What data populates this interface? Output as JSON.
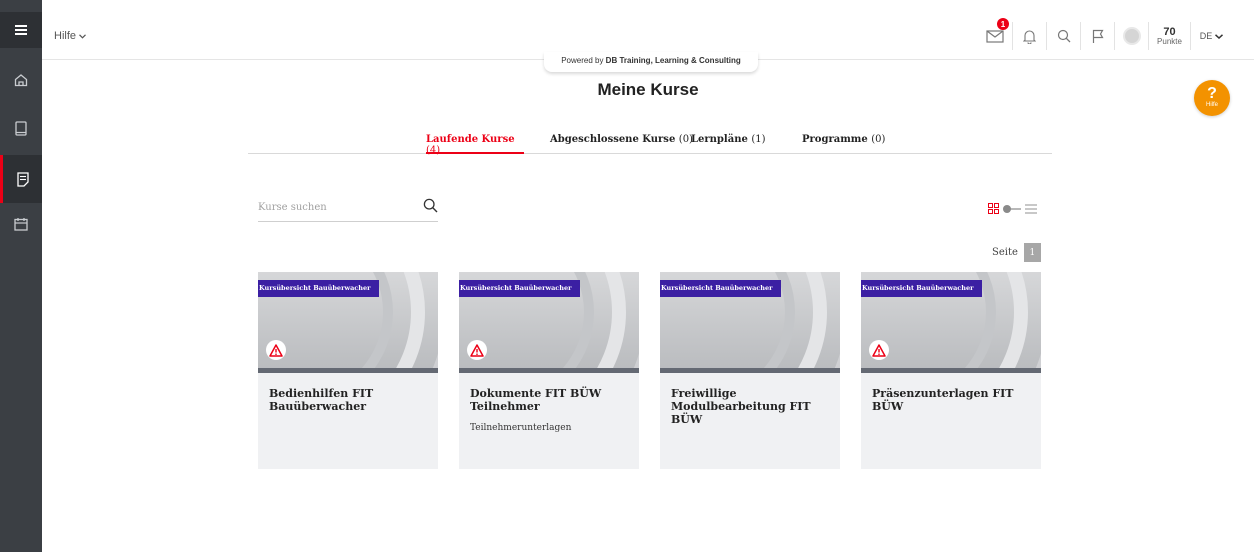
{
  "topbar": {
    "help_menu_label": "Hilfe",
    "messages_badge": "1",
    "points_value": "70",
    "points_label": "Punkte",
    "language": "DE"
  },
  "powered_by": {
    "prefix": "Powered by ",
    "brand": "DB Training, Learning & Consulting"
  },
  "page": {
    "title": "Meine Kurse"
  },
  "help_button": {
    "symbol": "?",
    "label": "Hilfe"
  },
  "tabs": [
    {
      "label": "Laufende Kurse",
      "count": "(4)"
    },
    {
      "label": "Abgeschlossene Kurse",
      "count": "(0)"
    },
    {
      "label": "Lernpläne",
      "count": "(1)"
    },
    {
      "label": "Programme",
      "count": "(0)"
    }
  ],
  "search": {
    "placeholder": "Kurse suchen"
  },
  "pagination": {
    "label": "Seite",
    "current": "1"
  },
  "courses": [
    {
      "category": "Kursübersicht Bauüberwacher",
      "title": "Bedienhilfen FIT Bauüberwacher",
      "subtitle": ""
    },
    {
      "category": "Kursübersicht Bauüberwacher",
      "title": "Dokumente FIT BÜW Teilnehmer",
      "subtitle": "Teilnehmerunterlagen"
    },
    {
      "category": "Kursübersicht Bauüberwacher",
      "title": "Freiwillige Modulbearbeitung FIT BÜW",
      "subtitle": ""
    },
    {
      "category": "Kursübersicht Bauüberwacher",
      "title": "Präsenzunterlagen FIT BÜW",
      "subtitle": ""
    }
  ],
  "colors": {
    "accent": "#ec0016",
    "ribbon": "#3b1fa3",
    "help": "#f39200",
    "sidebar": "#3b3f44"
  },
  "icons": {
    "sidebar": [
      "menu-icon",
      "home-icon",
      "tablet-icon",
      "courses-icon",
      "calendar-icon"
    ],
    "topbar": [
      "mail-icon",
      "bell-icon",
      "search-icon",
      "flag-icon",
      "avatar",
      "chevron-down-icon"
    ],
    "card": [
      "warning-icon"
    ]
  }
}
